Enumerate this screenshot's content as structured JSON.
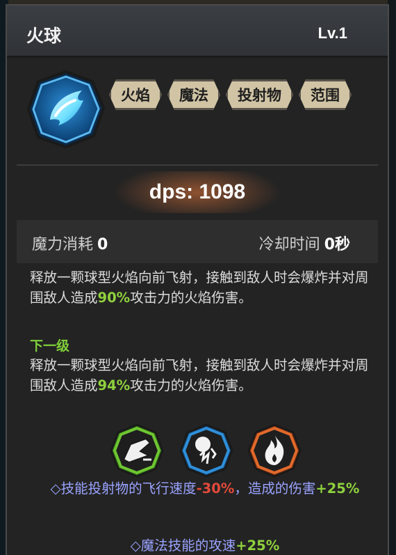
{
  "skill": {
    "name": "火球",
    "level": "Lv.1",
    "icon": "fireball-icon",
    "tags": [
      "火焰",
      "魔法",
      "投射物",
      "范围"
    ]
  },
  "stats": {
    "dps_label": "dps: 1098",
    "mana_label": "魔力消耗",
    "mana_value": "0",
    "cooldown_label": "冷却时间",
    "cooldown_value": "0秒"
  },
  "description": {
    "current_pre": "释放一颗球型火焰向前飞射，接触到敌人时会爆炸并对周围敌人造成",
    "current_pct": "90%",
    "current_post": "攻击力的火焰伤害。",
    "next_label": "下一级",
    "next_pre": "释放一颗球型火焰向前飞射，接触到敌人时会爆炸并对周围敌人造成",
    "next_pct": "94%",
    "next_post": "攻击力的火焰伤害。"
  },
  "talents": [
    {
      "icon": "projectile-speed-icon",
      "color": "#5fb82e"
    },
    {
      "icon": "magic-orb-icon",
      "color": "#2a7fc4"
    },
    {
      "icon": "flame-icon",
      "color": "#d9622a"
    }
  ],
  "bonuses": [
    {
      "pre": "◇技能投射物的飞行速度",
      "neg": "-30%",
      "mid": "，造成的伤害",
      "pos": "+25%"
    },
    {
      "pre": "◇魔法技能的攻速",
      "pos": "+25%"
    }
  ],
  "colors": {
    "positive": "#8fd13d",
    "negative": "#e24a3a",
    "bonus_text": "#9aa3ff",
    "tag_bg": "#d1c4a5"
  }
}
